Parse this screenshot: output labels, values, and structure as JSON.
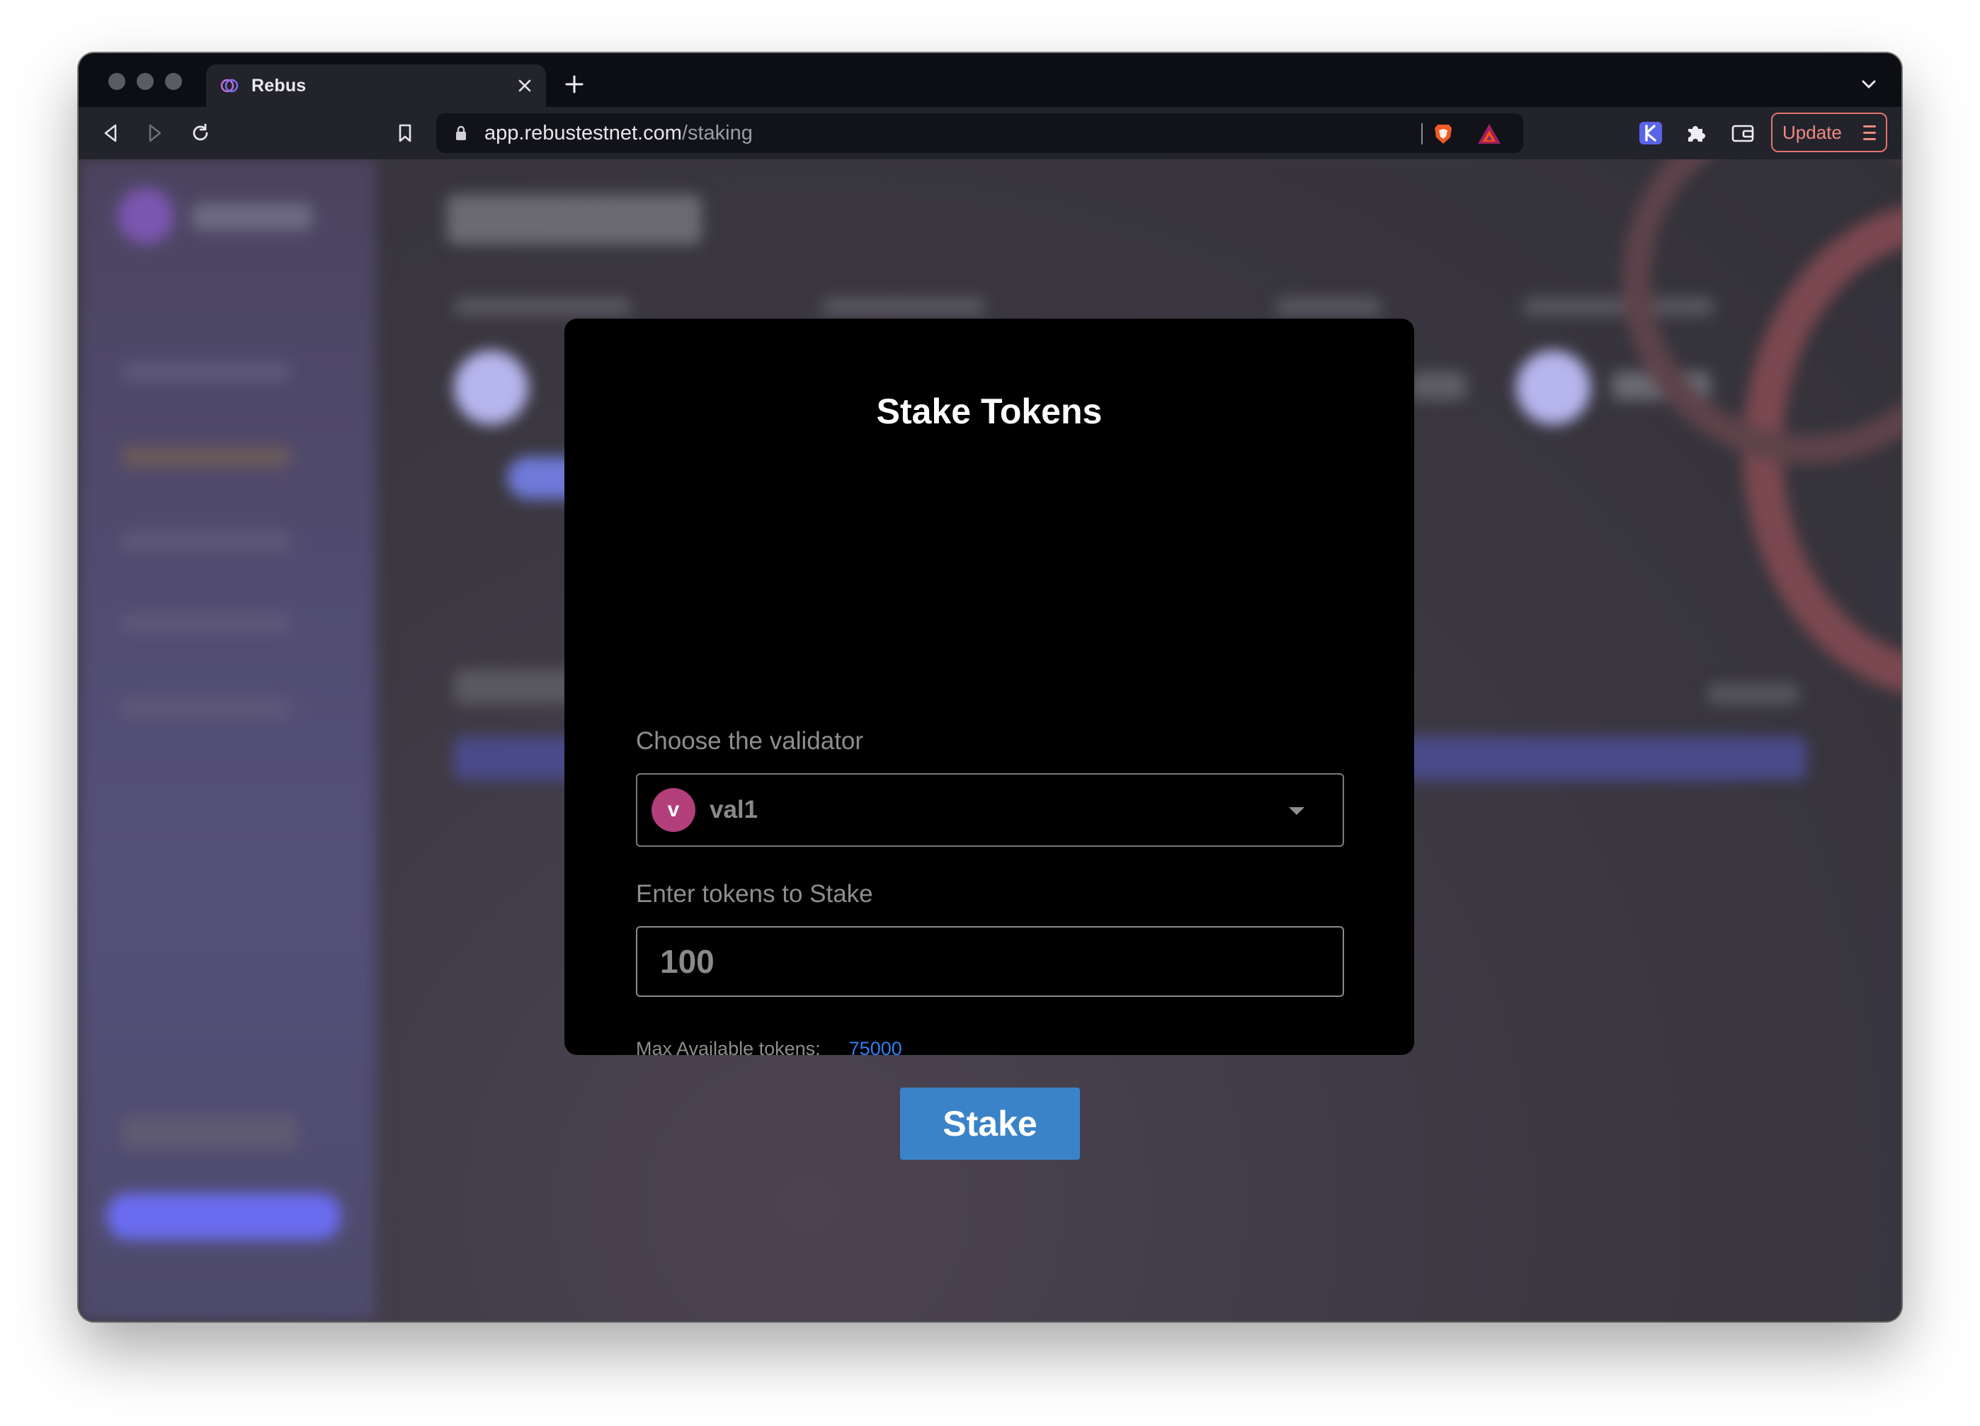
{
  "browser": {
    "tab": {
      "title": "Rebus",
      "favicon": "rebus-logo-icon"
    },
    "address": {
      "domain": "app.rebustestnet.com",
      "path": "/staking"
    },
    "update_label": "Update",
    "colors": {
      "update_accent": "#f08a7f",
      "tab_bg": "#23232c",
      "strip_bg": "#0d0d14"
    }
  },
  "modal": {
    "title": "Stake Tokens",
    "validator_label": "Choose the validator",
    "validator": {
      "initial": "v",
      "name": "val1",
      "avatar_color": "#b23e7a"
    },
    "tokens_label": "Enter tokens to Stake",
    "tokens_value": "100",
    "max_label": "Max Available tokens:",
    "max_value": "75000",
    "submit_label": "Stake",
    "colors": {
      "button": "#3b83c8",
      "link": "#2f7ff2"
    }
  }
}
